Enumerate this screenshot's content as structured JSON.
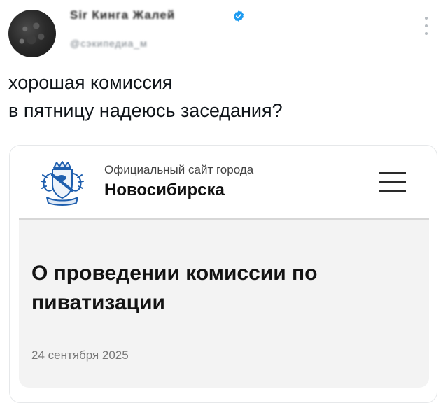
{
  "post": {
    "author_name": "Sir Кинга Жалей",
    "author_handle": "@сэкипедиа_м",
    "text_lines": [
      "хорошая комиссия",
      "в пятницу надеюсь заседания?"
    ]
  },
  "card": {
    "site_subtitle": "Официальный сайт города",
    "site_title": "Новосибирска",
    "news_title": "О проведении комиссии по пиватизации",
    "news_date": "24 сентября 2025"
  },
  "icons": {
    "verified": "verified-badge-icon",
    "more": "more-options-icon",
    "menu": "hamburger-menu-icon",
    "logo": "novosibirsk-coat-of-arms-logo"
  },
  "colors": {
    "verified_blue": "#1d9bf0",
    "logo_blue": "#1f5fae",
    "news_background": "#f3f3f3"
  }
}
